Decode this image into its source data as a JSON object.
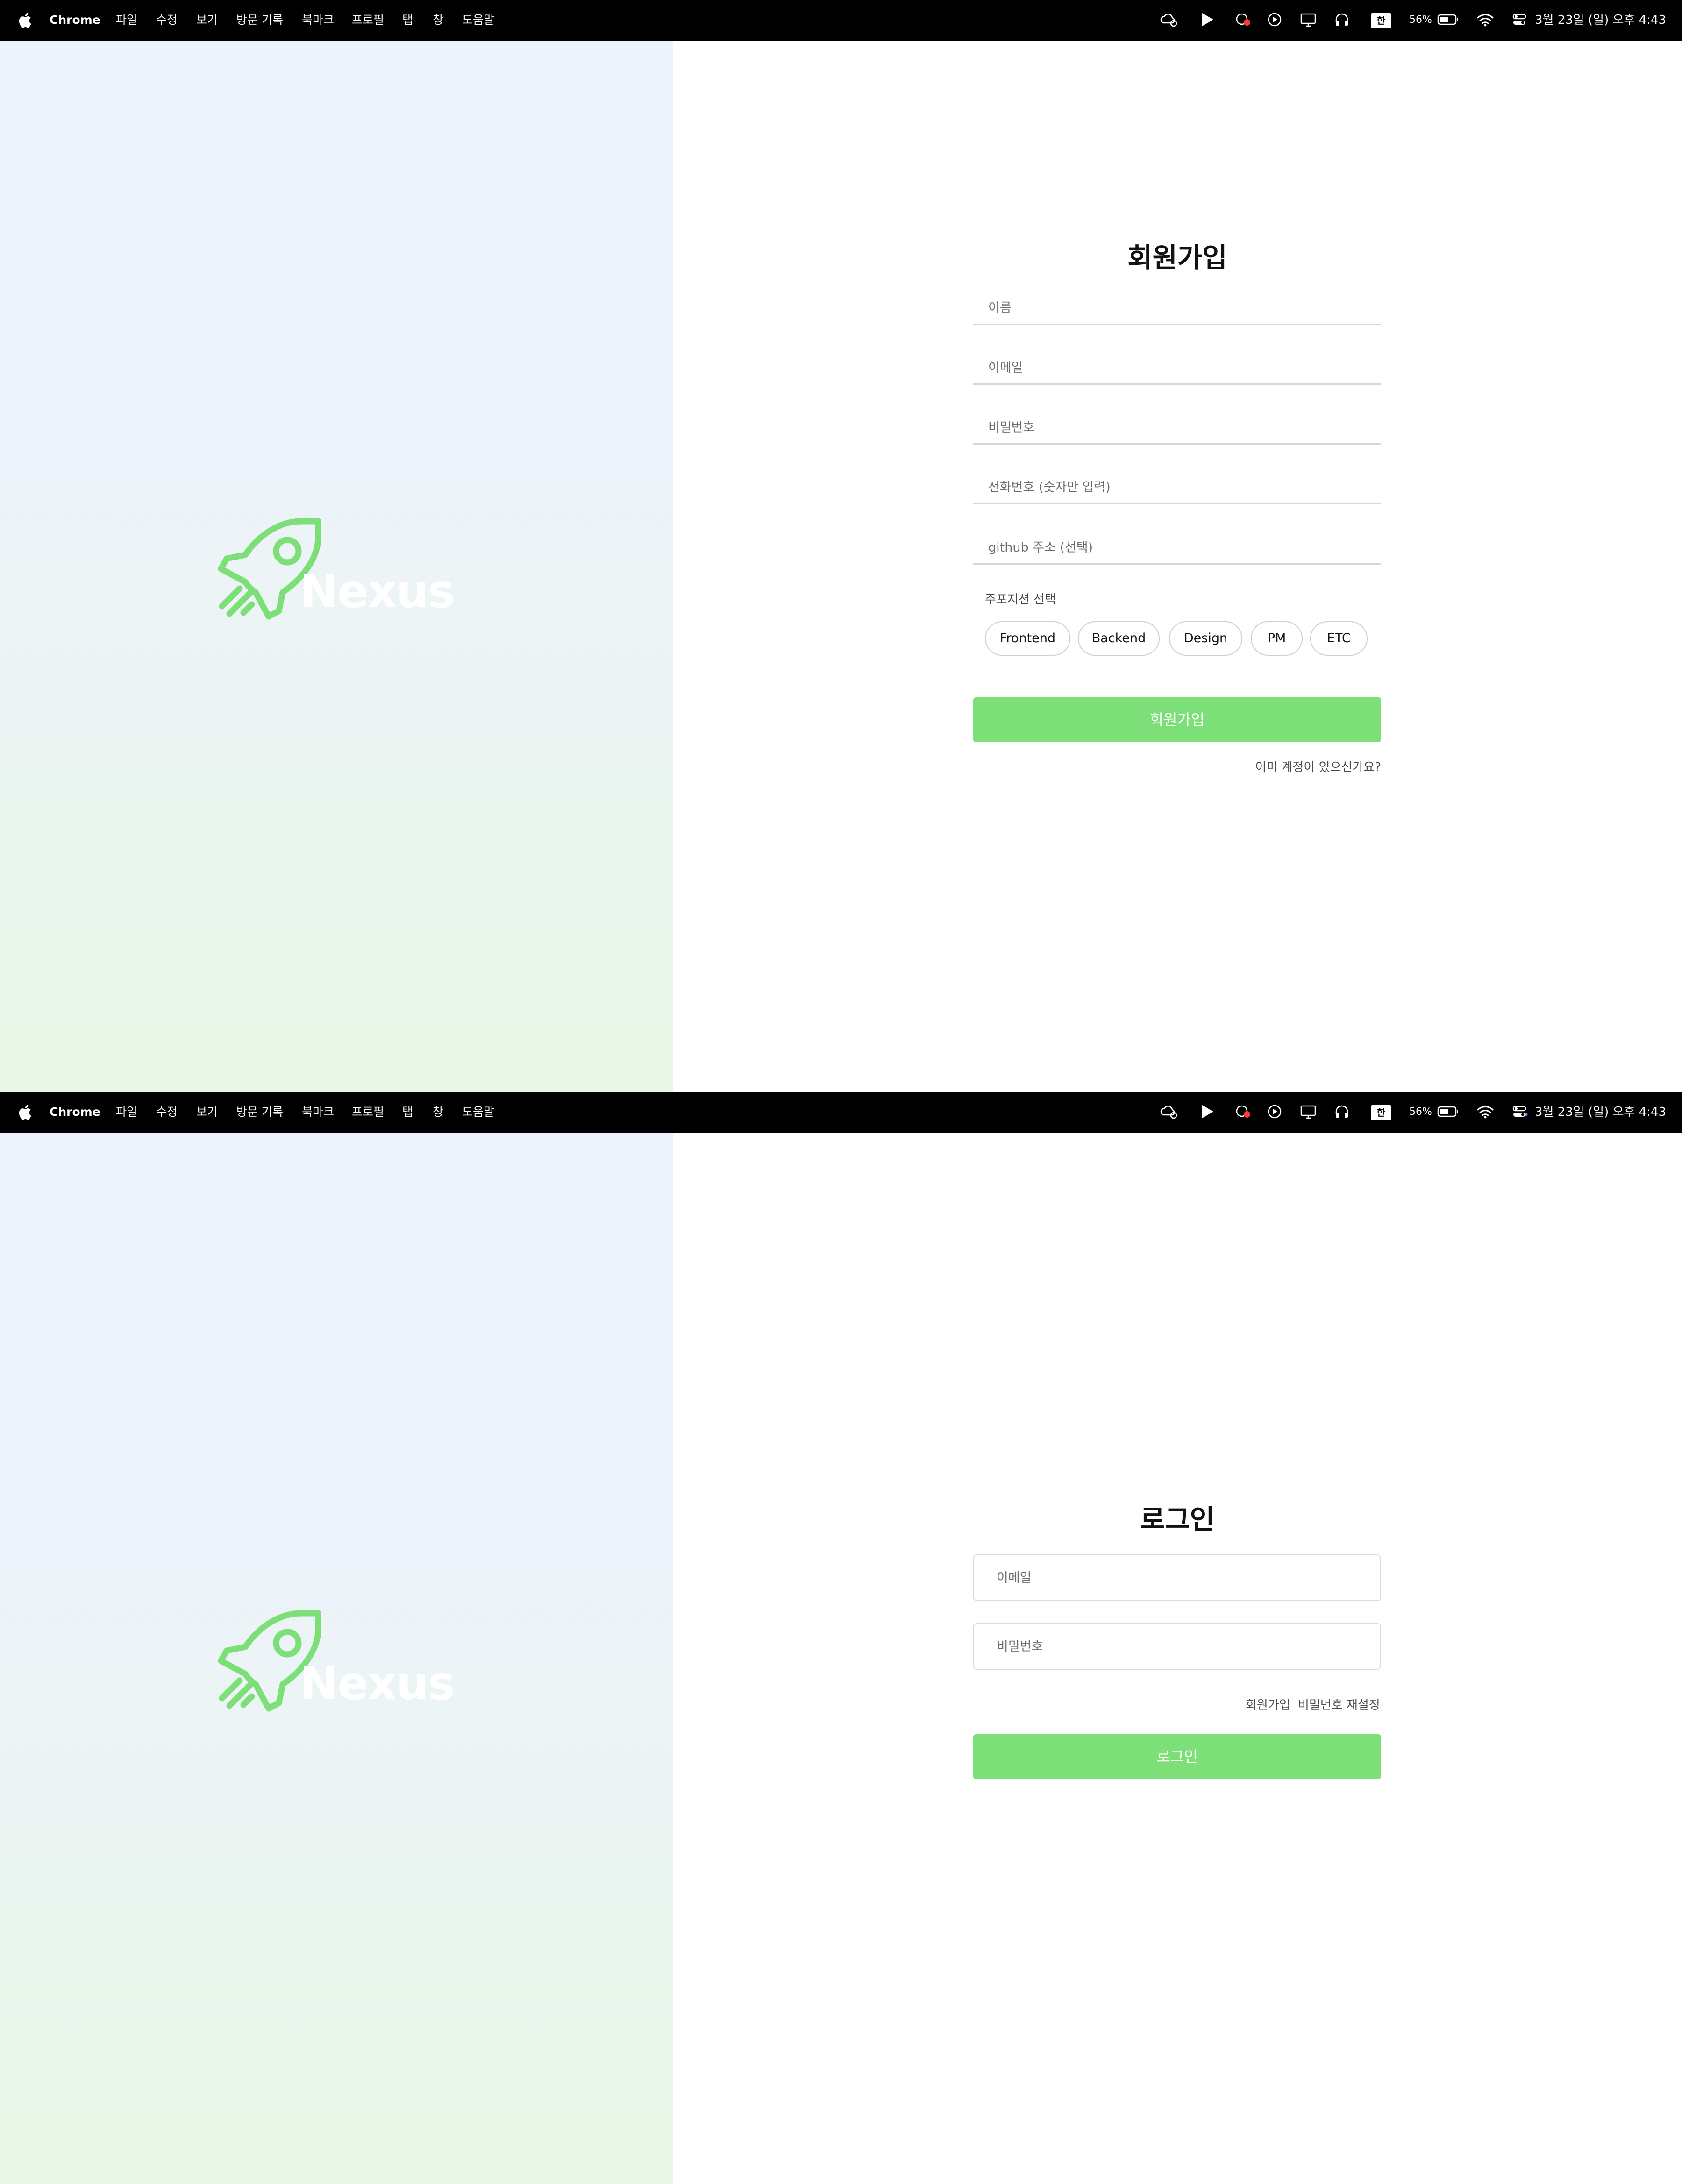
{
  "menubar": {
    "app": "Chrome",
    "menus": [
      "파일",
      "수정",
      "보기",
      "방문 기록",
      "북마크",
      "프로필",
      "탭",
      "창",
      "도움말"
    ],
    "ime": "한",
    "battery": "56%",
    "clock": "3월 23일 (일) 오후 4:43"
  },
  "brand": {
    "name": "Nexus",
    "accent": "#7ddf78"
  },
  "signup": {
    "title": "회원가입",
    "fields": {
      "name_placeholder": "이름",
      "email_placeholder": "이메일",
      "password_placeholder": "비밀번호",
      "phone_placeholder": "전화번호 (숫자만 입력)",
      "github_placeholder": "github 주소 (선택)"
    },
    "position_label": "주포지션 선택",
    "positions": [
      "Frontend",
      "Backend",
      "Design",
      "PM",
      "ETC"
    ],
    "submit": "회원가입",
    "login_link": "이미 계정이 있으신가요?"
  },
  "login": {
    "title": "로그인",
    "email_placeholder": "이메일",
    "password_placeholder": "비밀번호",
    "signup_link": "회원가입",
    "reset_link": "비밀번호 재설정",
    "submit": "로그인"
  }
}
